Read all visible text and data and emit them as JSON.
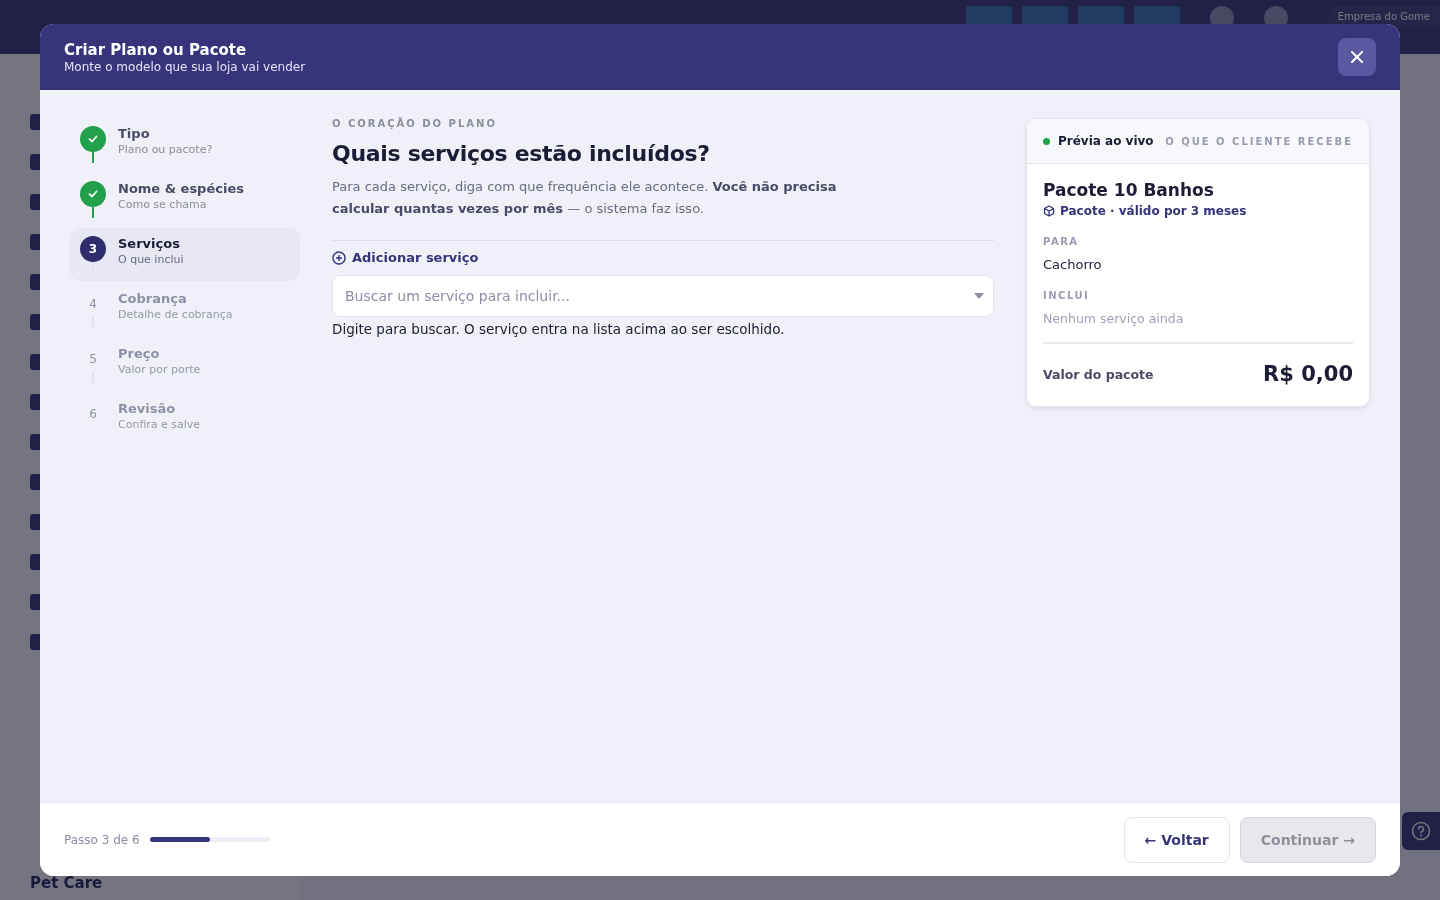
{
  "background": {
    "company_chip": "Empresa do Gome",
    "sidebar_footer": "Pet Care"
  },
  "modal": {
    "title": "Criar Plano ou Pacote",
    "subtitle": "Monte o modelo que sua loja vai vender"
  },
  "steps": [
    {
      "title": "Tipo",
      "subtitle": "Plano ou pacote?",
      "completed": true,
      "selected": false
    },
    {
      "title": "Nome & espécies",
      "subtitle": "Como se chama",
      "completed": true,
      "selected": false
    },
    {
      "number": "3",
      "title": "Serviços",
      "subtitle": "O que inclui",
      "completed": false,
      "selected": true
    },
    {
      "number": "4",
      "title": "Cobrança",
      "subtitle": "Detalhe de cobrança",
      "completed": false,
      "selected": false
    },
    {
      "number": "5",
      "title": "Preço",
      "subtitle": "Valor por porte",
      "completed": false,
      "selected": false
    },
    {
      "number": "6",
      "title": "Revisão",
      "subtitle": "Confira e salve",
      "completed": false,
      "selected": false
    }
  ],
  "content": {
    "eyebrow": "O CORAÇÃO DO PLANO",
    "heading": "Quais serviços estão incluídos?",
    "description": "Para cada serviço, diga com que frequência ele acontece. **Você não precisa calcular quantas vezes por mês** — o sistema faz isso.",
    "add_link": "Adicionar serviço",
    "search": {
      "placeholder": "Buscar um serviço para incluir..."
    },
    "hint": "Digite para buscar. O serviço entra na lista acima ao ser escolhido."
  },
  "preview": {
    "live_label": "Prévia ao vivo",
    "header_caption": "O QUE O CLIENTE RECEBE",
    "name": "Pacote 10 Banhos",
    "meta": "Pacote · válido por 3 meses",
    "for_label": "PARA",
    "for_value": "Cachorro",
    "includes_label": "INCLUI",
    "includes_empty": "Nenhum serviço ainda",
    "total_label": "Valor do pacote",
    "total_value": "R$ 0,00"
  },
  "footer": {
    "progress_label": "Passo 3 de 6",
    "level": 0.5,
    "back_button": "← Voltar",
    "continue_button": "Continuar →",
    "continue_disabled": true
  }
}
